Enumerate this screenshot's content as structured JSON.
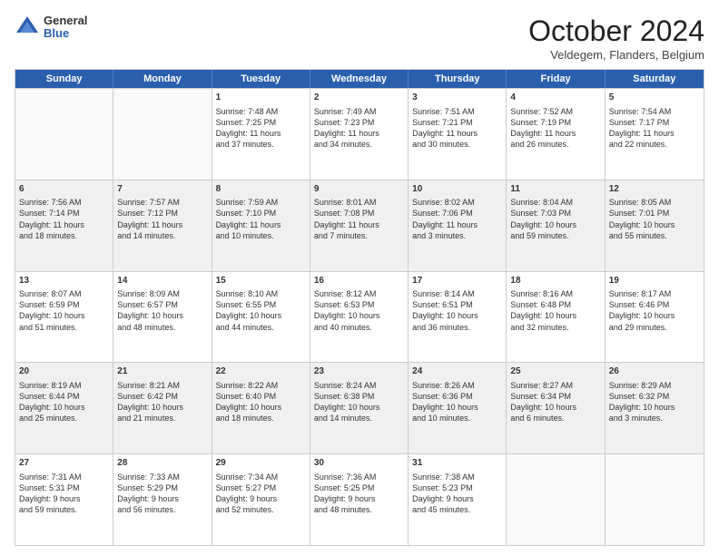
{
  "header": {
    "logo": {
      "general": "General",
      "blue": "Blue"
    },
    "title": "October 2024",
    "subtitle": "Veldegem, Flanders, Belgium"
  },
  "days": [
    "Sunday",
    "Monday",
    "Tuesday",
    "Wednesday",
    "Thursday",
    "Friday",
    "Saturday"
  ],
  "weeks": [
    [
      {
        "day": "",
        "empty": true
      },
      {
        "day": "",
        "empty": true
      },
      {
        "day": "1",
        "l1": "Sunrise: 7:48 AM",
        "l2": "Sunset: 7:25 PM",
        "l3": "Daylight: 11 hours",
        "l4": "and 37 minutes."
      },
      {
        "day": "2",
        "l1": "Sunrise: 7:49 AM",
        "l2": "Sunset: 7:23 PM",
        "l3": "Daylight: 11 hours",
        "l4": "and 34 minutes."
      },
      {
        "day": "3",
        "l1": "Sunrise: 7:51 AM",
        "l2": "Sunset: 7:21 PM",
        "l3": "Daylight: 11 hours",
        "l4": "and 30 minutes."
      },
      {
        "day": "4",
        "l1": "Sunrise: 7:52 AM",
        "l2": "Sunset: 7:19 PM",
        "l3": "Daylight: 11 hours",
        "l4": "and 26 minutes."
      },
      {
        "day": "5",
        "l1": "Sunrise: 7:54 AM",
        "l2": "Sunset: 7:17 PM",
        "l3": "Daylight: 11 hours",
        "l4": "and 22 minutes."
      }
    ],
    [
      {
        "day": "6",
        "l1": "Sunrise: 7:56 AM",
        "l2": "Sunset: 7:14 PM",
        "l3": "Daylight: 11 hours",
        "l4": "and 18 minutes."
      },
      {
        "day": "7",
        "l1": "Sunrise: 7:57 AM",
        "l2": "Sunset: 7:12 PM",
        "l3": "Daylight: 11 hours",
        "l4": "and 14 minutes."
      },
      {
        "day": "8",
        "l1": "Sunrise: 7:59 AM",
        "l2": "Sunset: 7:10 PM",
        "l3": "Daylight: 11 hours",
        "l4": "and 10 minutes."
      },
      {
        "day": "9",
        "l1": "Sunrise: 8:01 AM",
        "l2": "Sunset: 7:08 PM",
        "l3": "Daylight: 11 hours",
        "l4": "and 7 minutes."
      },
      {
        "day": "10",
        "l1": "Sunrise: 8:02 AM",
        "l2": "Sunset: 7:06 PM",
        "l3": "Daylight: 11 hours",
        "l4": "and 3 minutes."
      },
      {
        "day": "11",
        "l1": "Sunrise: 8:04 AM",
        "l2": "Sunset: 7:03 PM",
        "l3": "Daylight: 10 hours",
        "l4": "and 59 minutes."
      },
      {
        "day": "12",
        "l1": "Sunrise: 8:05 AM",
        "l2": "Sunset: 7:01 PM",
        "l3": "Daylight: 10 hours",
        "l4": "and 55 minutes."
      }
    ],
    [
      {
        "day": "13",
        "l1": "Sunrise: 8:07 AM",
        "l2": "Sunset: 6:59 PM",
        "l3": "Daylight: 10 hours",
        "l4": "and 51 minutes."
      },
      {
        "day": "14",
        "l1": "Sunrise: 8:09 AM",
        "l2": "Sunset: 6:57 PM",
        "l3": "Daylight: 10 hours",
        "l4": "and 48 minutes."
      },
      {
        "day": "15",
        "l1": "Sunrise: 8:10 AM",
        "l2": "Sunset: 6:55 PM",
        "l3": "Daylight: 10 hours",
        "l4": "and 44 minutes."
      },
      {
        "day": "16",
        "l1": "Sunrise: 8:12 AM",
        "l2": "Sunset: 6:53 PM",
        "l3": "Daylight: 10 hours",
        "l4": "and 40 minutes."
      },
      {
        "day": "17",
        "l1": "Sunrise: 8:14 AM",
        "l2": "Sunset: 6:51 PM",
        "l3": "Daylight: 10 hours",
        "l4": "and 36 minutes."
      },
      {
        "day": "18",
        "l1": "Sunrise: 8:16 AM",
        "l2": "Sunset: 6:48 PM",
        "l3": "Daylight: 10 hours",
        "l4": "and 32 minutes."
      },
      {
        "day": "19",
        "l1": "Sunrise: 8:17 AM",
        "l2": "Sunset: 6:46 PM",
        "l3": "Daylight: 10 hours",
        "l4": "and 29 minutes."
      }
    ],
    [
      {
        "day": "20",
        "l1": "Sunrise: 8:19 AM",
        "l2": "Sunset: 6:44 PM",
        "l3": "Daylight: 10 hours",
        "l4": "and 25 minutes."
      },
      {
        "day": "21",
        "l1": "Sunrise: 8:21 AM",
        "l2": "Sunset: 6:42 PM",
        "l3": "Daylight: 10 hours",
        "l4": "and 21 minutes."
      },
      {
        "day": "22",
        "l1": "Sunrise: 8:22 AM",
        "l2": "Sunset: 6:40 PM",
        "l3": "Daylight: 10 hours",
        "l4": "and 18 minutes."
      },
      {
        "day": "23",
        "l1": "Sunrise: 8:24 AM",
        "l2": "Sunset: 6:38 PM",
        "l3": "Daylight: 10 hours",
        "l4": "and 14 minutes."
      },
      {
        "day": "24",
        "l1": "Sunrise: 8:26 AM",
        "l2": "Sunset: 6:36 PM",
        "l3": "Daylight: 10 hours",
        "l4": "and 10 minutes."
      },
      {
        "day": "25",
        "l1": "Sunrise: 8:27 AM",
        "l2": "Sunset: 6:34 PM",
        "l3": "Daylight: 10 hours",
        "l4": "and 6 minutes."
      },
      {
        "day": "26",
        "l1": "Sunrise: 8:29 AM",
        "l2": "Sunset: 6:32 PM",
        "l3": "Daylight: 10 hours",
        "l4": "and 3 minutes."
      }
    ],
    [
      {
        "day": "27",
        "l1": "Sunrise: 7:31 AM",
        "l2": "Sunset: 5:31 PM",
        "l3": "Daylight: 9 hours",
        "l4": "and 59 minutes."
      },
      {
        "day": "28",
        "l1": "Sunrise: 7:33 AM",
        "l2": "Sunset: 5:29 PM",
        "l3": "Daylight: 9 hours",
        "l4": "and 56 minutes."
      },
      {
        "day": "29",
        "l1": "Sunrise: 7:34 AM",
        "l2": "Sunset: 5:27 PM",
        "l3": "Daylight: 9 hours",
        "l4": "and 52 minutes."
      },
      {
        "day": "30",
        "l1": "Sunrise: 7:36 AM",
        "l2": "Sunset: 5:25 PM",
        "l3": "Daylight: 9 hours",
        "l4": "and 48 minutes."
      },
      {
        "day": "31",
        "l1": "Sunrise: 7:38 AM",
        "l2": "Sunset: 5:23 PM",
        "l3": "Daylight: 9 hours",
        "l4": "and 45 minutes."
      },
      {
        "day": "",
        "empty": true
      },
      {
        "day": "",
        "empty": true
      }
    ]
  ]
}
